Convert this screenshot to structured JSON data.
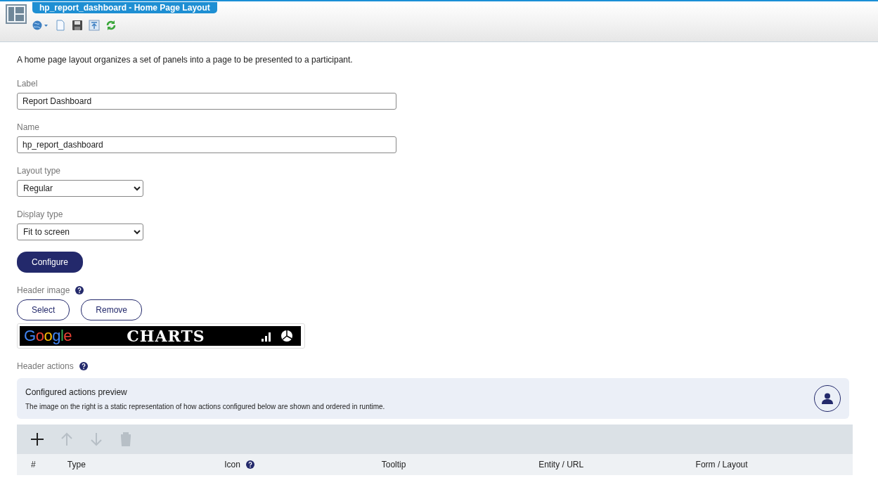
{
  "window": {
    "title": "hp_report_dashboard - Home Page Layout"
  },
  "toolbar": [
    {
      "kind": "globe-menu"
    },
    {
      "kind": "new"
    },
    {
      "kind": "save"
    },
    {
      "kind": "export"
    },
    {
      "kind": "refresh"
    }
  ],
  "description": "A home page layout organizes a set of panels into a page to be presented to a participant.",
  "fields": [
    {
      "kind": "text",
      "label": "Label",
      "value": "Report Dashboard"
    },
    {
      "kind": "text",
      "label": "Name",
      "value": "hp_report_dashboard"
    },
    {
      "kind": "select",
      "label": "Layout type",
      "value": "Regular"
    },
    {
      "kind": "select",
      "label": "Display type",
      "value": "Fit to screen"
    }
  ],
  "configure_button": "Configure",
  "header_image": {
    "label": "Header image",
    "buttons": [
      "Select",
      "Remove"
    ],
    "logo_word": "Google",
    "logo_title": "CHARTS"
  },
  "header_actions": {
    "label": "Header actions",
    "preview": {
      "title": "Configured actions preview",
      "text": "The image on the right is a static representation of how actions configured below are shown and ordered in runtime."
    },
    "tools": [
      {
        "kind": "add",
        "disabled": false
      },
      {
        "kind": "up",
        "disabled": true
      },
      {
        "kind": "down",
        "disabled": true
      },
      {
        "kind": "delete",
        "disabled": true
      }
    ],
    "columns": [
      {
        "label": "#",
        "help": false
      },
      {
        "label": "Type",
        "help": false
      },
      {
        "label": "Icon",
        "help": true
      },
      {
        "label": "Tooltip",
        "help": false
      },
      {
        "label": "Entity / URL",
        "help": false
      },
      {
        "label": "Form / Layout",
        "help": false
      }
    ]
  }
}
